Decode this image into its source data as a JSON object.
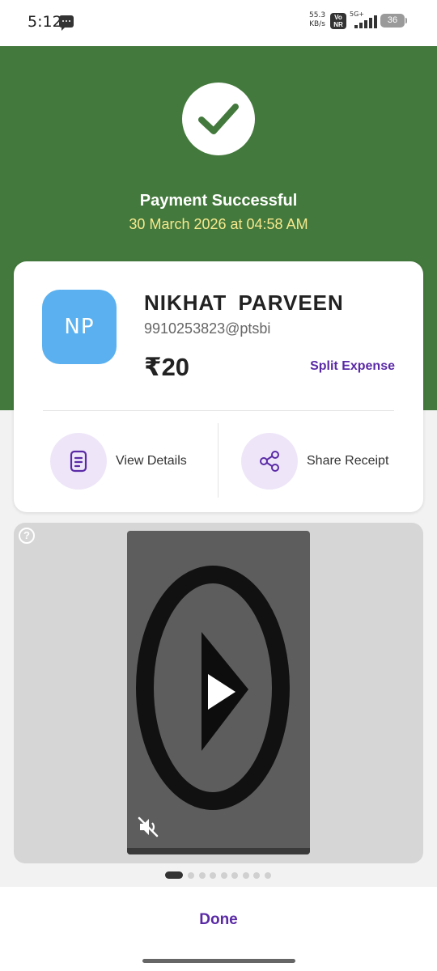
{
  "status_bar": {
    "time": "5:12",
    "net_speed_value": "55.3",
    "net_speed_unit": "KB/s",
    "vonr_line1": "Vo",
    "vonr_line2": "NR",
    "network": "5G+",
    "battery": "36",
    "icons": [
      "message-icon",
      "vonr-icon",
      "signal-icon",
      "battery-icon"
    ]
  },
  "header": {
    "background_color": "#43793c",
    "status_icon": "check-icon",
    "title": "Payment Successful",
    "datetime": "30 March 2026 at 04:58 AM"
  },
  "payee": {
    "initials": "NP",
    "avatar_color": "#5bb1f0",
    "name": "NIKHAT  PARVEEN",
    "upi_id": "9910253823@ptsbi",
    "amount": "₹20",
    "split_label": "Split Expense"
  },
  "actions": [
    {
      "icon": "document-icon",
      "label": "View Details"
    },
    {
      "icon": "share-icon",
      "label": "Share Receipt"
    }
  ],
  "media": {
    "help_icon": "?",
    "video_icons": [
      "play-icon",
      "mute-icon"
    ]
  },
  "pager": {
    "total": 9,
    "active": 0
  },
  "done_label": "Done",
  "accent_color": "#5a2aa6"
}
